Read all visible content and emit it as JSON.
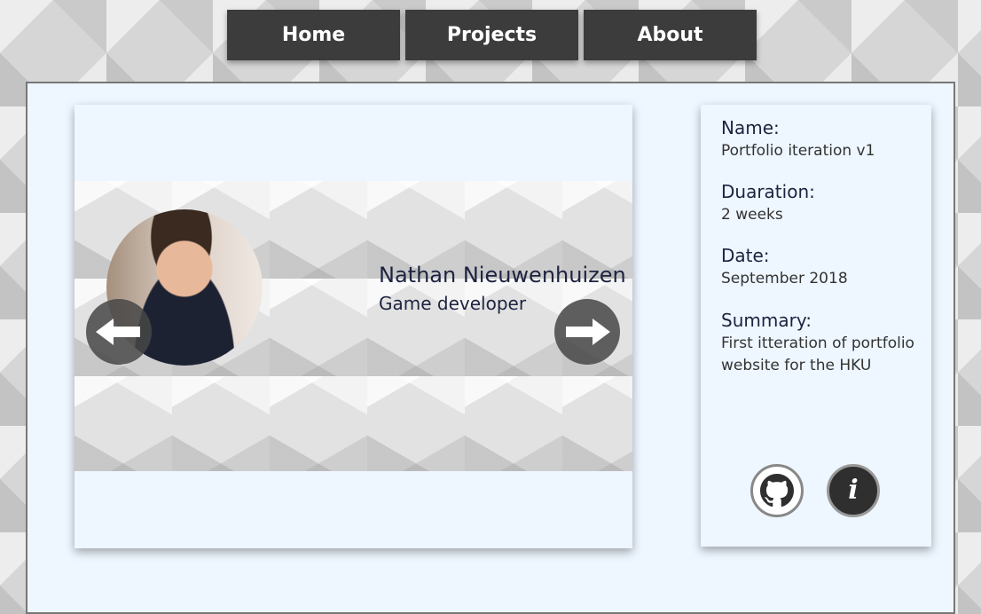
{
  "nav": {
    "home_label": "Home",
    "projects_label": "Projects",
    "about_label": "About"
  },
  "slide": {
    "name": "Nathan Nieuwenhuizen",
    "role": "Game developer"
  },
  "info": {
    "name_label": "Name:",
    "name_value": "Portfolio iteration v1",
    "duration_label": "Duaration:",
    "duration_value": "2 weeks",
    "date_label": "Date:",
    "date_value": "September 2018",
    "summary_label": "Summary:",
    "summary_value": "First itteration of portfolio website for the HKU"
  },
  "icons": {
    "prev": "arrow-left-icon",
    "next": "arrow-right-icon",
    "github": "github-icon",
    "info": "info-icon"
  },
  "colors": {
    "nav_bg": "#3c3c3c",
    "panel_bg": "#eef6ff",
    "text_dark": "#1d2340"
  }
}
